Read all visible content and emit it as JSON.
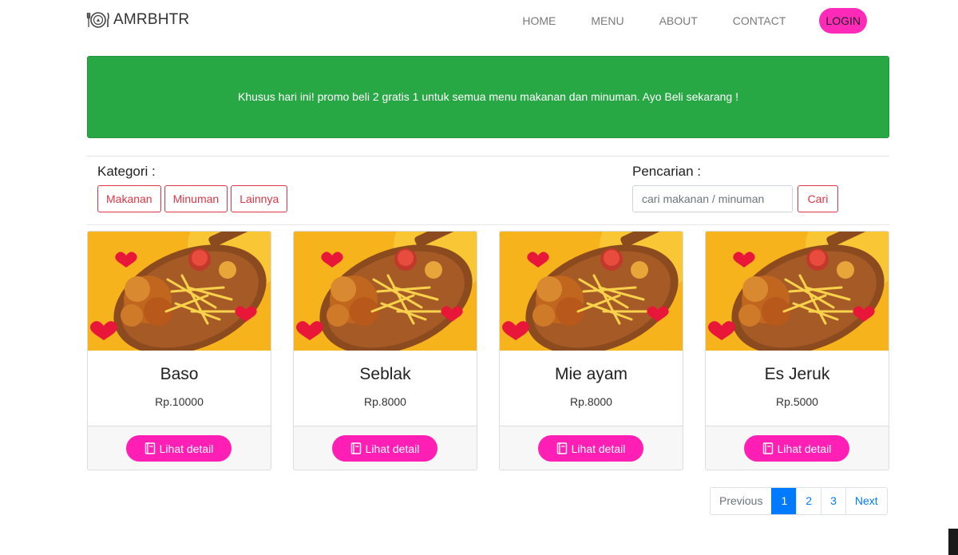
{
  "navbar": {
    "brand": "AMRBHTR",
    "links": [
      "HOME",
      "MENU",
      "ABOUT",
      "CONTACT"
    ],
    "login": "LOGIN"
  },
  "promo": {
    "text": "Khusus hari ini! promo beli 2 gratis 1 untuk semua menu makanan dan minuman. Ayo Beli sekarang !"
  },
  "filter": {
    "kategori_label": "Kategori :",
    "categories": [
      "Makanan",
      "Minuman",
      "Lainnya"
    ],
    "search_label": "Pencarian :",
    "search_placeholder": "cari makanan / minuman",
    "search_value": "",
    "search_button": "Cari"
  },
  "products": [
    {
      "name": "Baso",
      "price": "Rp.10000",
      "button": "Lihat detail"
    },
    {
      "name": "Seblak",
      "price": "Rp.8000",
      "button": "Lihat detail"
    },
    {
      "name": "Mie ayam",
      "price": "Rp.8000",
      "button": "Lihat detail"
    },
    {
      "name": "Es Jeruk",
      "price": "Rp.5000",
      "button": "Lihat detail"
    }
  ],
  "pagination": {
    "previous": "Previous",
    "pages": [
      "1",
      "2",
      "3"
    ],
    "active": "1",
    "next": "Next"
  },
  "colors": {
    "primary_pink": "#ff1fb4",
    "promo_green": "#28a745",
    "category_red": "#dc3545",
    "pagination_blue": "#007bff"
  }
}
